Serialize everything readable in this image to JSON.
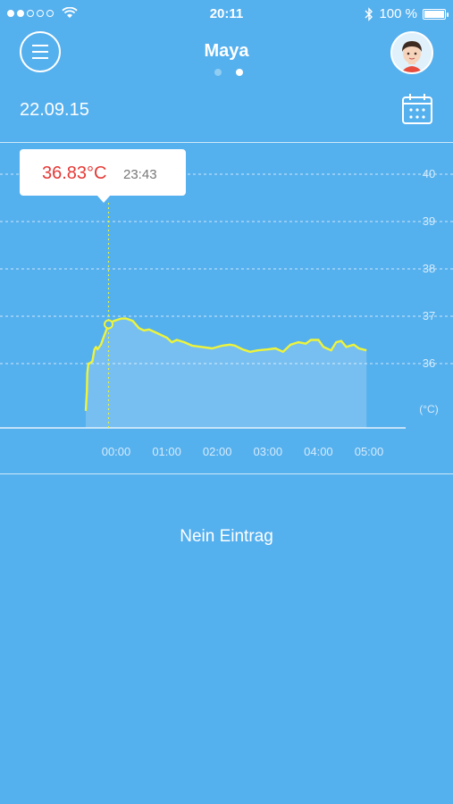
{
  "status": {
    "time": "20:11",
    "battery": "100 %",
    "battery_level": 1.0
  },
  "header": {
    "title": "Maya",
    "page_count": 2,
    "current_page": 2
  },
  "date": "22.09.15",
  "tooltip": {
    "temp": "36.83°C",
    "time": "23:43"
  },
  "empty_message": "Nein Eintrag",
  "colors": {
    "background": "#55b0ee",
    "line": "#eef43a",
    "tooltip_temp": "#e53935"
  },
  "chart_data": {
    "type": "line",
    "title": "",
    "xlabel": "",
    "ylabel": "(°C)",
    "x_ticks": [
      "00:00",
      "01:00",
      "02:00",
      "03:00",
      "04:00",
      "05:00"
    ],
    "y_ticks": [
      "40",
      "39",
      "38",
      "37",
      "36"
    ],
    "ylim": [
      35.0,
      40.0
    ],
    "x_range_hours": [
      -0.6,
      5.0
    ],
    "grid": "horizontal dashed",
    "series": [
      {
        "x": [
          -0.6,
          -0.58,
          -0.57,
          -0.55,
          -0.53,
          -0.47,
          -0.43,
          -0.4,
          -0.37,
          -0.3,
          -0.25,
          -0.15,
          -0.05,
          0.1,
          0.2,
          0.33,
          0.45,
          0.55,
          0.65,
          0.8,
          1.0,
          1.1,
          1.2,
          1.35,
          1.5,
          1.7,
          1.9,
          2.1,
          2.25,
          2.35,
          2.5,
          2.65,
          2.8,
          3.0,
          3.15,
          3.3,
          3.45,
          3.6,
          3.75,
          3.85,
          4.0,
          4.1,
          4.25,
          4.35,
          4.45,
          4.55,
          4.7,
          4.8,
          4.95
        ],
        "values": [
          35.0,
          35.4,
          35.8,
          36.0,
          36.0,
          36.05,
          36.3,
          36.35,
          36.3,
          36.4,
          36.55,
          36.83,
          36.9,
          36.95,
          36.95,
          36.9,
          36.75,
          36.7,
          36.72,
          36.65,
          36.55,
          36.45,
          36.5,
          36.45,
          36.38,
          36.35,
          36.32,
          36.38,
          36.4,
          36.38,
          36.3,
          36.25,
          36.28,
          36.3,
          36.32,
          36.25,
          36.4,
          36.45,
          36.42,
          36.5,
          36.5,
          36.35,
          36.28,
          36.45,
          36.48,
          36.35,
          36.4,
          36.32,
          36.28
        ]
      }
    ],
    "highlight": {
      "x": -0.15,
      "y": 36.83
    }
  }
}
